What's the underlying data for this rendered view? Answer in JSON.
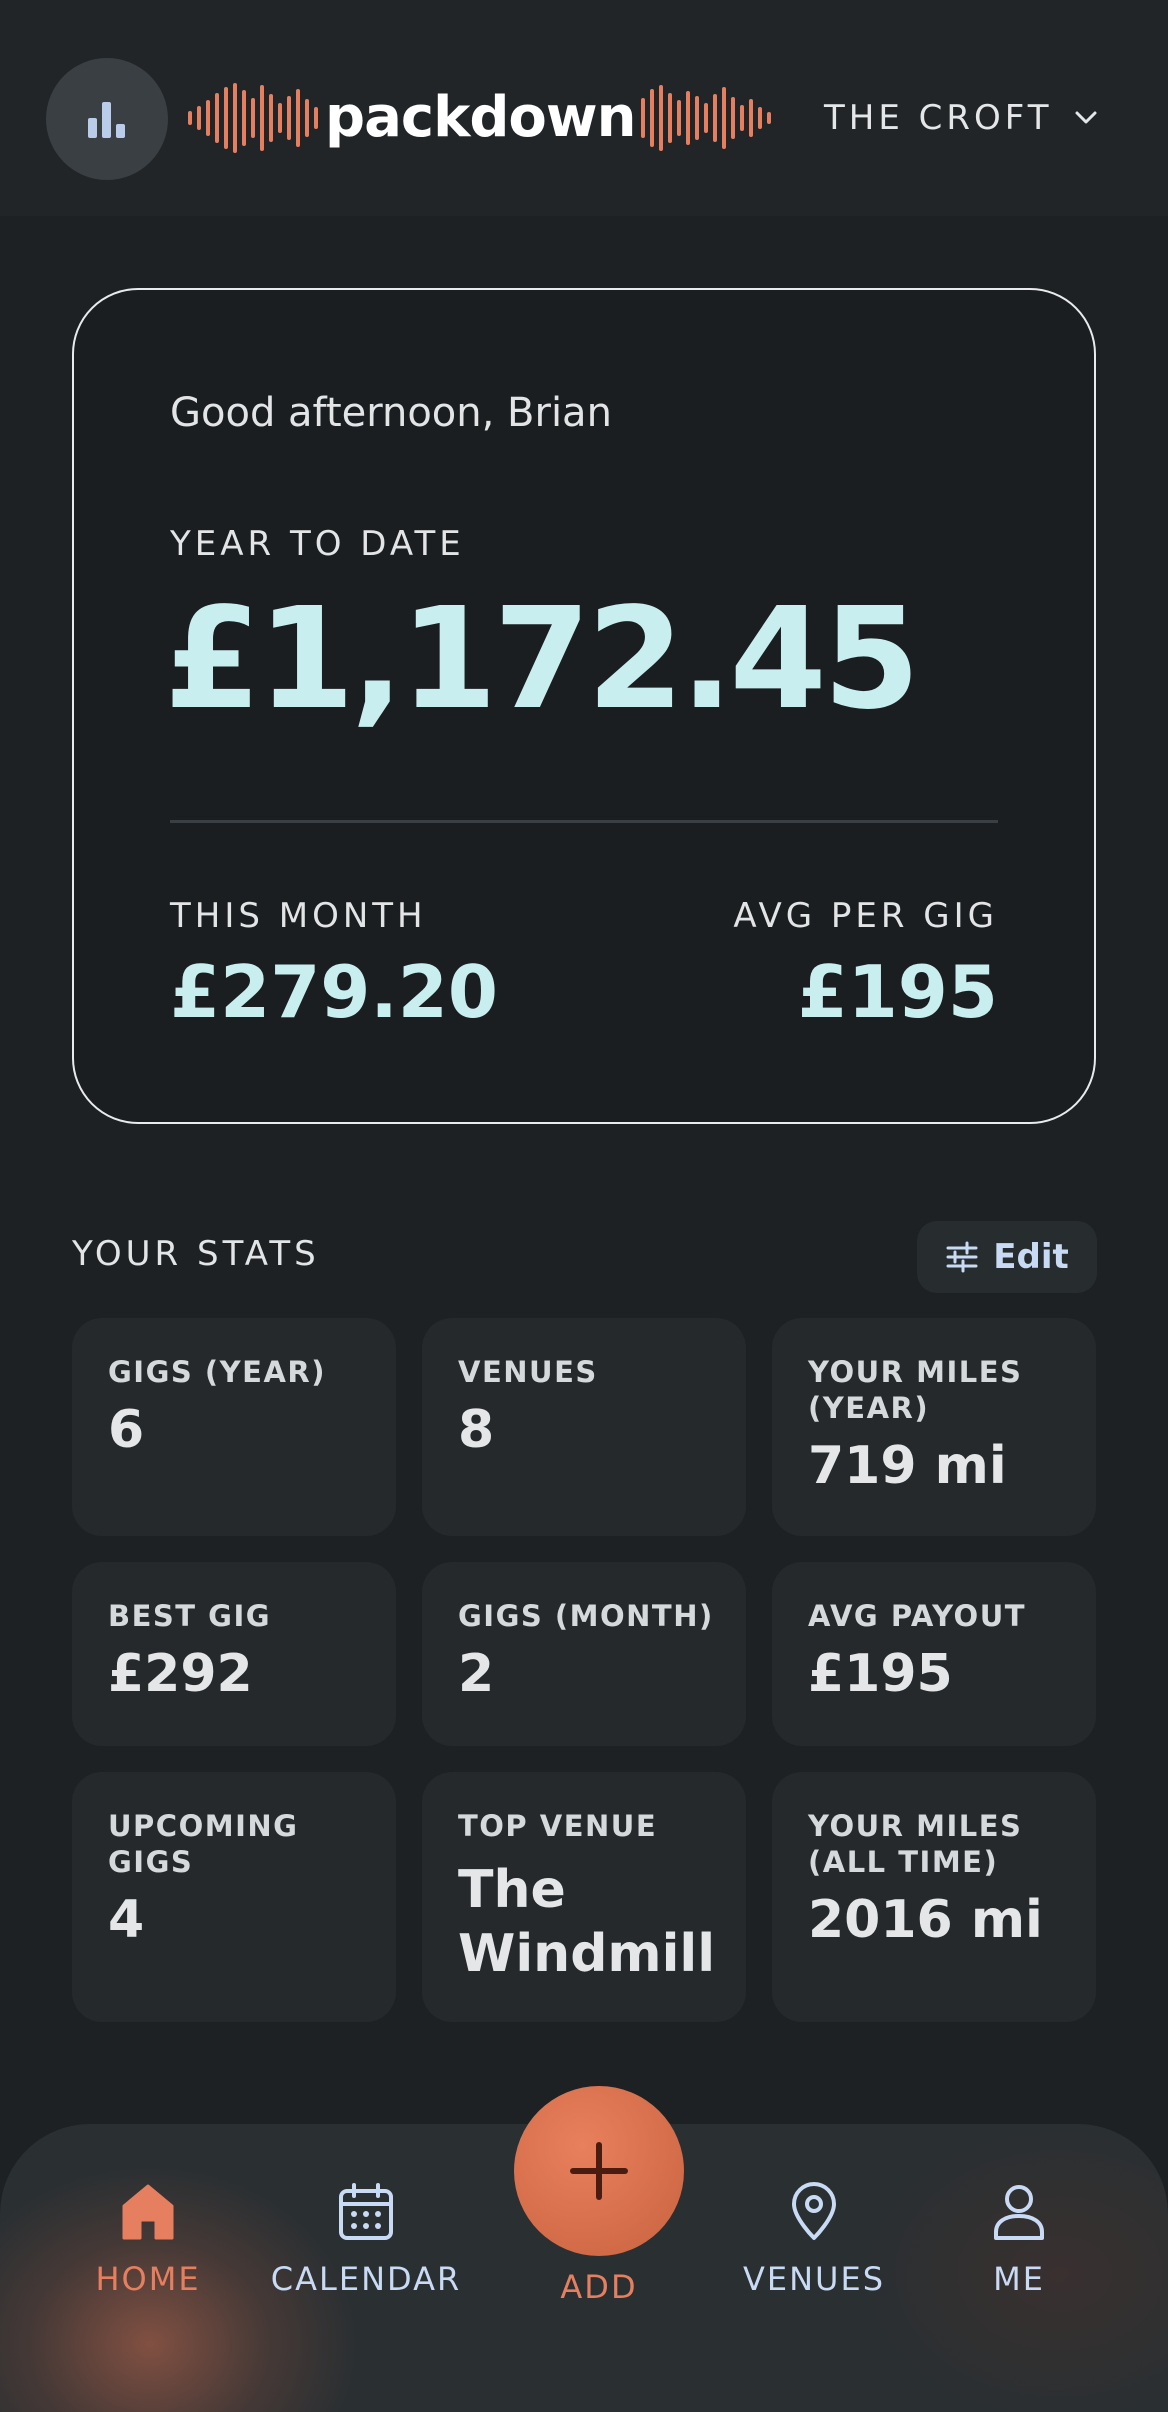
{
  "header": {
    "logo_text": "packdown",
    "venue_selector": "THE CROFT",
    "stats_icon": "bar-chart-icon",
    "chevron_icon": "chevron-down-icon"
  },
  "summary": {
    "greeting": "Good afternoon, Brian",
    "ytd_label": "YEAR TO DATE",
    "ytd_value": "£1,172.45",
    "month_label": "THIS MONTH",
    "month_value": "£279.20",
    "avg_label": "AVG PER GIG",
    "avg_value": "£195"
  },
  "stats": {
    "title": "YOUR STATS",
    "edit_label": "Edit",
    "edit_icon": "sliders-icon",
    "tiles": [
      {
        "label": "GIGS (YEAR)",
        "value": "6"
      },
      {
        "label": "VENUES",
        "value": "8"
      },
      {
        "label": "YOUR MILES (YEAR)",
        "value": "719 mi"
      },
      {
        "label": "BEST GIG",
        "value": "£292"
      },
      {
        "label": "GIGS (MONTH)",
        "value": "2"
      },
      {
        "label": "AVG PAYOUT",
        "value": "£195"
      },
      {
        "label": "UPCOMING GIGS",
        "value": "4"
      },
      {
        "label": "TOP VENUE",
        "value": "The Windmill"
      },
      {
        "label": "YOUR MILES (ALL TIME)",
        "value": "2016 mi"
      }
    ]
  },
  "nav": {
    "home": "HOME",
    "calendar": "CALENDAR",
    "add": "ADD",
    "venues": "VENUES",
    "me": "ME"
  },
  "colors": {
    "background": "#1d2124",
    "accent": "#e57f5f",
    "money": "#c9eef0",
    "nav_inactive": "#c8daf4"
  }
}
